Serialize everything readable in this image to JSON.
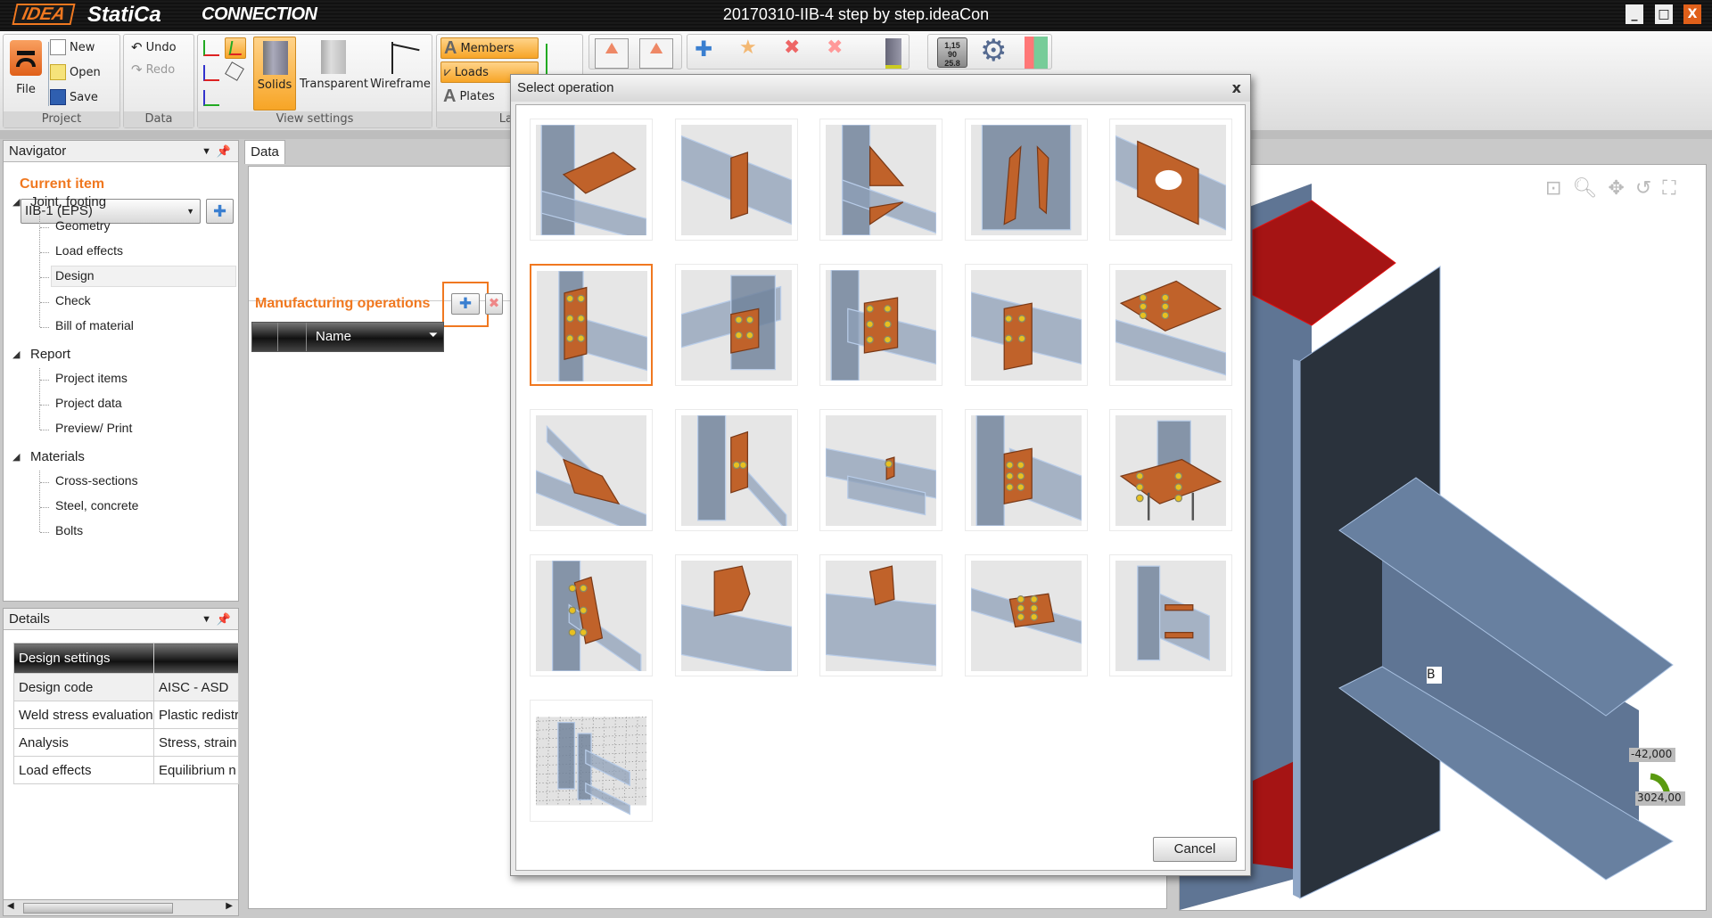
{
  "window": {
    "brand_mark": "IDEA",
    "brand": "StatiCa",
    "product": "CONNECTION",
    "title": "20170310-IIB-4 step by step.ideaCon",
    "minimize": "_",
    "maximize": "□",
    "close": "X"
  },
  "ribbon": {
    "project": {
      "label": "Project",
      "file": "File",
      "new": "New",
      "open": "Open",
      "save": "Save"
    },
    "data": {
      "label": "Data",
      "undo": "Undo",
      "redo": "Redo"
    },
    "view": {
      "label": "View settings",
      "solids": "Solids",
      "transparent": "Transparent",
      "wireframe": "Wireframe"
    },
    "labels": {
      "label": "Lab",
      "members": "Members",
      "loads": "Loads",
      "plates": "Plates"
    },
    "check_badge": [
      "1,15",
      "90",
      "25.8"
    ]
  },
  "navigator": {
    "title": "Navigator",
    "current_item_label": "Current item",
    "current_item_value": "IIB-1 (EPS)",
    "groups": [
      {
        "label": "Joint, footing",
        "items": [
          "Geometry",
          "Load effects",
          "Design",
          "Check",
          "Bill of material"
        ]
      },
      {
        "label": "Report",
        "items": [
          "Project items",
          "Project data",
          "Preview/ Print"
        ]
      },
      {
        "label": "Materials",
        "items": [
          "Cross-sections",
          "Steel, concrete",
          "Bolts"
        ]
      }
    ],
    "selected": "Design"
  },
  "details": {
    "title": "Details",
    "header": "Design settings",
    "rows": [
      {
        "label": "Design code",
        "value": "AISC - ASD"
      },
      {
        "label": "Weld stress evaluation",
        "value": "Plastic redistr"
      },
      {
        "label": "Analysis",
        "value": "Stress, strain"
      },
      {
        "label": "Load effects",
        "value": "Equilibrium n"
      }
    ]
  },
  "data_tab": {
    "tab": "Data",
    "section_title": "Manufacturing operations",
    "grid_header": "Name"
  },
  "viewport": {
    "member_label": "B",
    "load_values": [
      "-42,000",
      "3024,00"
    ]
  },
  "dialog": {
    "title": "Select operation",
    "close": "x",
    "cancel": "Cancel",
    "selected_index": 5,
    "operations": [
      {
        "icon": "stiffening-plate-icon",
        "kind": "wing"
      },
      {
        "icon": "plate-cut-icon",
        "kind": "cut"
      },
      {
        "icon": "haunch-icon",
        "kind": "haunch"
      },
      {
        "icon": "rib-icon",
        "kind": "ribs"
      },
      {
        "icon": "opening-icon",
        "kind": "opening"
      },
      {
        "icon": "end-plate-icon",
        "kind": "endplate"
      },
      {
        "icon": "fin-plate-icon",
        "kind": "fin"
      },
      {
        "icon": "column-end-plate-icon",
        "kind": "colplate"
      },
      {
        "icon": "splice-icon",
        "kind": "splice"
      },
      {
        "icon": "plate-to-plate-icon",
        "kind": "flatbolts"
      },
      {
        "icon": "gusset-icon",
        "kind": "gusset"
      },
      {
        "icon": "cleat-icon",
        "kind": "cleat"
      },
      {
        "icon": "beam-seat-icon",
        "kind": "seat"
      },
      {
        "icon": "double-angle-icon",
        "kind": "angles"
      },
      {
        "icon": "base-plate-icon",
        "kind": "base"
      },
      {
        "icon": "brace-connection-icon",
        "kind": "brace"
      },
      {
        "icon": "notch-plate-icon",
        "kind": "notch"
      },
      {
        "icon": "fin-stub-icon",
        "kind": "stub"
      },
      {
        "icon": "bolted-flange-icon",
        "kind": "flange"
      },
      {
        "icon": "stiffener-cross-icon",
        "kind": "cross"
      },
      {
        "icon": "grid-template-icon",
        "kind": "grid"
      }
    ]
  },
  "colors": {
    "accent": "#f07820",
    "steel": "#6a80a0",
    "plate": "#c0622a",
    "bolt": "#e8c020",
    "load": "#a01414"
  }
}
